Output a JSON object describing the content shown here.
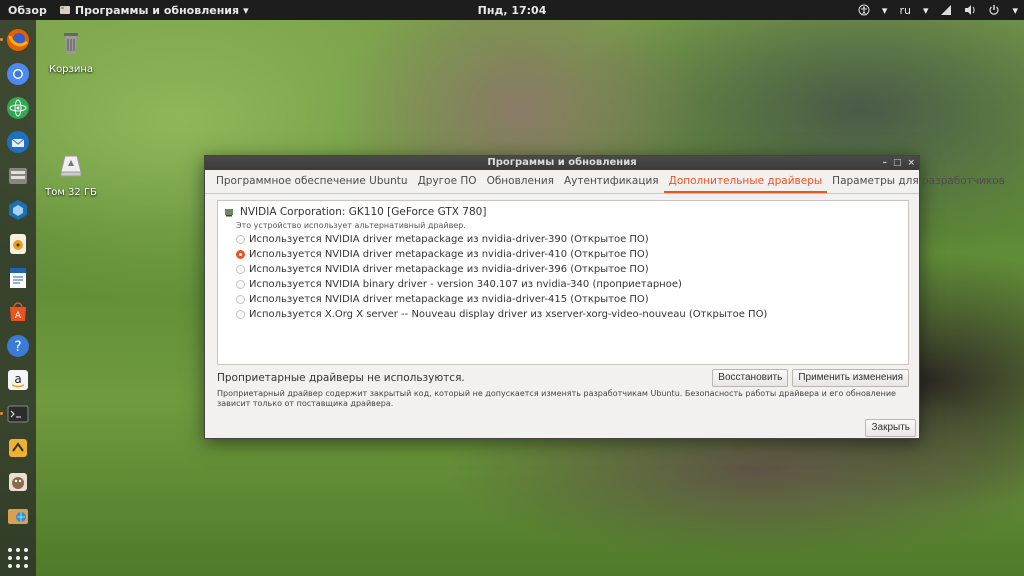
{
  "topbar": {
    "activities": "Обзор",
    "app_name": "Программы и обновления",
    "clock": "Пнд, 17:04",
    "lang": "ru"
  },
  "desktop": {
    "trash_label": "Корзина",
    "volume_label": "Том 32 ГБ"
  },
  "dock": {
    "items": [
      "firefox-icon",
      "chromium-icon",
      "atom-icon",
      "thunderbird-icon",
      "files-icon",
      "virtualbox-icon",
      "rhythmbox-icon",
      "writer-icon",
      "software-center-icon",
      "help-icon",
      "amazon-icon",
      "terminal-icon",
      "software-updater-icon",
      "gimp-icon",
      "web-browser-icon"
    ]
  },
  "window": {
    "title": "Программы и обновления",
    "tabs": [
      {
        "label": "Программное обеспечение Ubuntu",
        "active": false
      },
      {
        "label": "Другое ПО",
        "active": false
      },
      {
        "label": "Обновления",
        "active": false
      },
      {
        "label": "Аутентификация",
        "active": false
      },
      {
        "label": "Дополнительные драйверы",
        "active": true
      },
      {
        "label": "Параметры для разработчиков",
        "active": false
      }
    ],
    "device": {
      "name": "NVIDIA Corporation: GK110 [GeForce GTX 780]",
      "subtitle": "Это устройство использует альтернативный драйвер."
    },
    "drivers": [
      {
        "label": "Используется NVIDIA driver metapackage из nvidia-driver-390 (Открытое ПО)",
        "selected": false
      },
      {
        "label": "Используется NVIDIA driver metapackage из nvidia-driver-410 (Открытое ПО)",
        "selected": true
      },
      {
        "label": "Используется NVIDIA driver metapackage из nvidia-driver-396 (Открытое ПО)",
        "selected": false
      },
      {
        "label": "Используется NVIDIA binary driver - version 340.107 из nvidia-340 (проприетарное)",
        "selected": false
      },
      {
        "label": "Используется NVIDIA driver metapackage из nvidia-driver-415 (Открытое ПО)",
        "selected": false
      },
      {
        "label": "Используется X.Org X server -- Nouveau display driver из xserver-xorg-video-nouveau (Открытое ПО)",
        "selected": false
      }
    ],
    "status": "Проприетарные драйверы не используются.",
    "revert_label": "Восстановить",
    "apply_label": "Применить изменения",
    "note": "Проприетарный драйвер содержит закрытый код, который не допускается изменять разработчикам Ubuntu. Безопасность работы драйвера и его обновление зависит только от поставщика драйвера.",
    "close_label": "Закрыть"
  },
  "colors": {
    "accent": "#e95420",
    "topbar": "#1d1d1d",
    "window_bg": "#f2f1f0"
  }
}
